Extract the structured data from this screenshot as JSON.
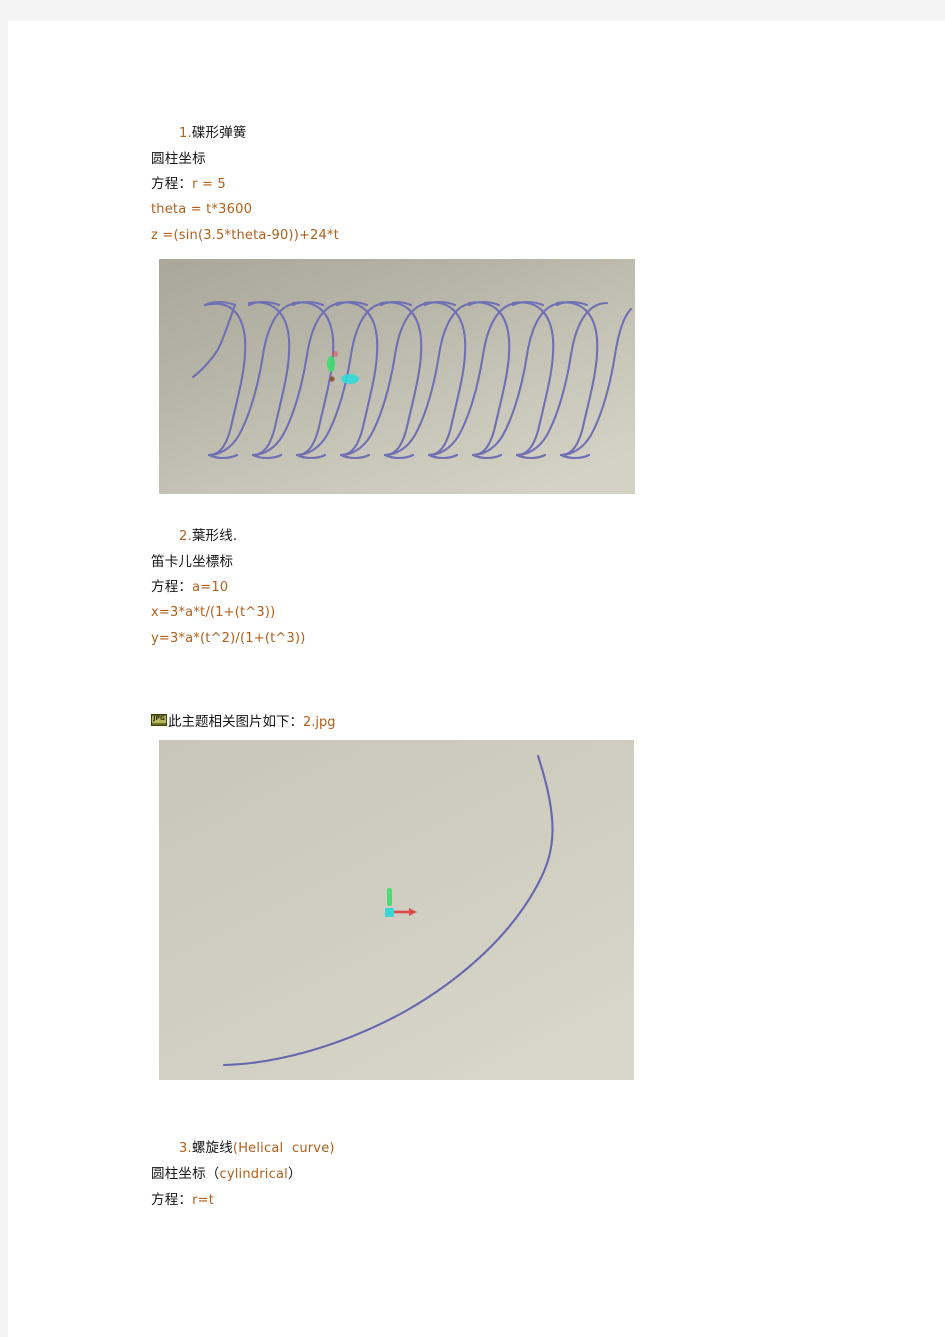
{
  "document": {
    "background_color": "#f4f4f4",
    "page_color": "#ffffff",
    "latin_ink_color": "#b25f1a",
    "cjk_ink_color": "#141414"
  },
  "sections": [
    {
      "id": "section-1",
      "heading_number": "1.",
      "heading_title": "碟形弹簧",
      "coordinate_system": "圆柱坐标",
      "equation_label": "方程：",
      "equations": [
        "r = 5",
        "theta = t*3600",
        "z =(sin(3.5*theta-90))+24*t"
      ]
    },
    {
      "id": "section-2",
      "heading_number": "2.",
      "heading_title": "葉形线.",
      "coordinate_system": "笛卡儿坐標标",
      "equation_label": "方程：",
      "equations": [
        "a=10",
        "x=3*a*t/(1+(t^3))",
        "y=3*a*(t^2)/(1+(t^3))"
      ]
    },
    {
      "id": "section-3",
      "heading_number": "3.",
      "heading_title": "螺旋线",
      "heading_suffix": "(Helical  curve)",
      "coordinate_system_cjk": "圆柱坐标（",
      "coordinate_system_latin": "cylindrical",
      "coordinate_system_close": "）",
      "equation_label": "方程：",
      "equations": [
        "r=t"
      ]
    }
  ],
  "attachment": {
    "icon_name": "jpg-file-icon",
    "icon_label": "JPG",
    "text_prefix": "此主题相关图片如下：",
    "filename": "2.jpg"
  },
  "figures": [
    {
      "id": "figure-1",
      "caption_implicit": "碟形弹簧 helical spring screenshot",
      "curve_color": "#6f6fb4",
      "axis_colors": {
        "y_axis": "#3ddc6a",
        "x_axis": "#33d9d9",
        "z_axis": "#e05b5b",
        "origin": "#8a5a3a"
      },
      "background": "beige-gray gradient"
    },
    {
      "id": "figure-2",
      "caption_implicit": "葉形线 folium of Descartes screenshot",
      "curve_color": "#6565b0",
      "axis_colors": {
        "y_axis": "#4ddc74",
        "x_axis": "#3ad6d6",
        "z_axis": "#e04b4b",
        "origin": "#33d9d9"
      },
      "background": "beige-gray gradient"
    }
  ]
}
